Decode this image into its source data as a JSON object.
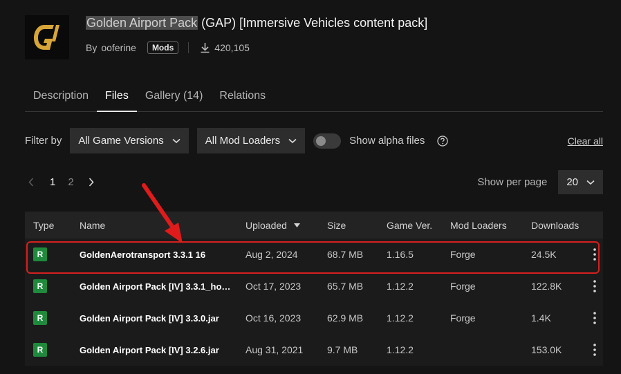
{
  "project": {
    "title_highlight": "Golden Airport Pack",
    "title_rest": " (GAP) [Immersive Vehicles content pack]",
    "by_label": "By",
    "author": "ooferine",
    "category": "Mods",
    "downloads": "420,105",
    "logo_icon": "gap-logo-icon",
    "logo_color": "#d7a637"
  },
  "tabs": [
    {
      "label": "Description",
      "active": false
    },
    {
      "label": "Files",
      "active": true
    },
    {
      "label": "Gallery (14)",
      "active": false
    },
    {
      "label": "Relations",
      "active": false
    }
  ],
  "filters": {
    "label": "Filter by",
    "game_versions": "All Game Versions",
    "mod_loaders": "All Mod Loaders",
    "alpha_label": "Show alpha files",
    "alpha_enabled": false,
    "clear_all": "Clear all"
  },
  "pagination": {
    "pages": [
      "1",
      "2"
    ],
    "current": "1",
    "per_page_label": "Show per page",
    "per_page_value": "20"
  },
  "table": {
    "headers": {
      "type": "Type",
      "name": "Name",
      "uploaded": "Uploaded",
      "size": "Size",
      "game_ver": "Game Ver.",
      "mod_loaders": "Mod Loaders",
      "downloads": "Downloads"
    },
    "rows": [
      {
        "type": "R",
        "name": "GoldenAerotransport 3.3.1 16",
        "uploaded": "Aug 2, 2024",
        "size": "68.7 MB",
        "game_ver": "1.16.5",
        "mod_loader": "Forge",
        "downloads": "24.5K"
      },
      {
        "type": "R",
        "name": "Golden Airport Pack [IV] 3.3.1_ho…",
        "uploaded": "Oct 17, 2023",
        "size": "65.7 MB",
        "game_ver": "1.12.2",
        "mod_loader": "Forge",
        "downloads": "122.8K"
      },
      {
        "type": "R",
        "name": "Golden Airport Pack [IV] 3.3.0.jar",
        "uploaded": "Oct 16, 2023",
        "size": "62.9 MB",
        "game_ver": "1.12.2",
        "mod_loader": "Forge",
        "downloads": "1.4K"
      },
      {
        "type": "R",
        "name": "Golden Airport Pack [IV] 3.2.6.jar",
        "uploaded": "Aug 31, 2021",
        "size": "9.7 MB",
        "game_ver": "1.12.2",
        "mod_loader": "",
        "downloads": "153.0K"
      }
    ]
  },
  "colors": {
    "release_badge": "#1f8a3d",
    "annotation": "#d81f1f"
  }
}
